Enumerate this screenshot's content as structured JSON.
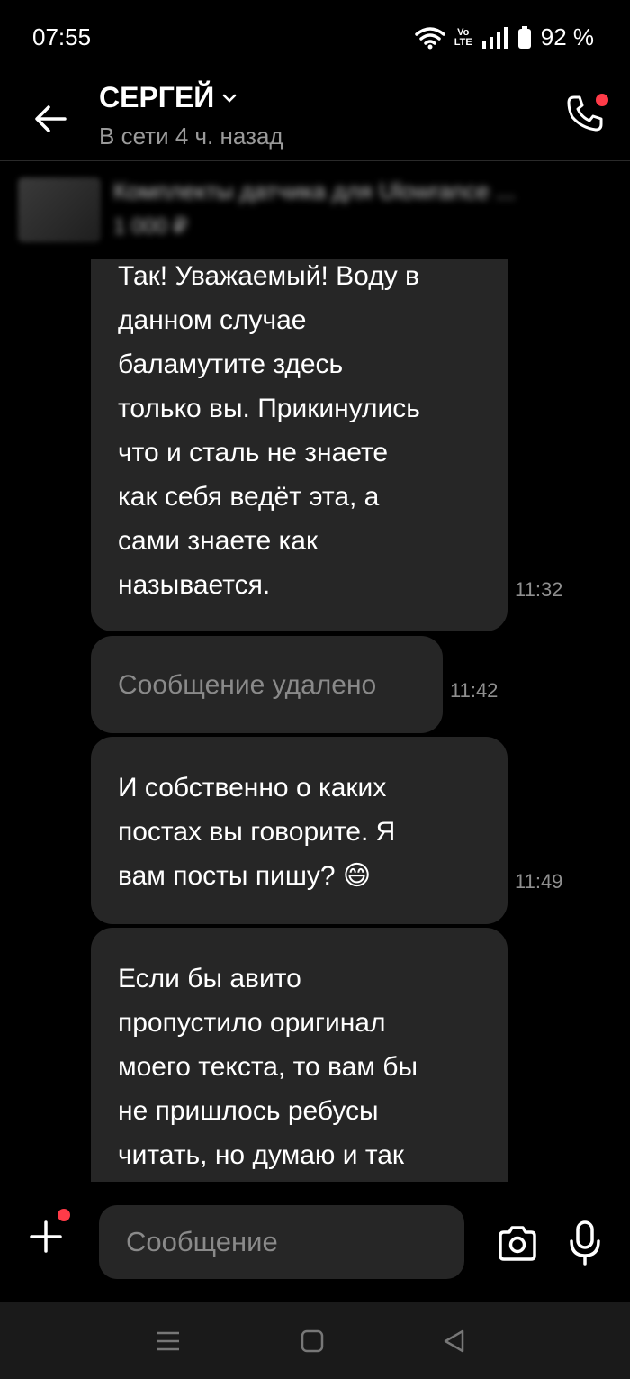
{
  "status_bar": {
    "time": "07:55",
    "volte_top": "Vo",
    "volte_bottom": "LTE",
    "battery": "92 %"
  },
  "header": {
    "contact_name": "СЕРГЕЙ",
    "contact_status": "В сети 4 ч. назад"
  },
  "ad": {
    "title": "Комплекты датчика для Ulowrance ...",
    "price": "1 000 ₽"
  },
  "messages": [
    {
      "text": "Так! Уважаемый! Воду в\nданном случае\nбаламутите здесь\nтолько вы. Прикинулись\nчто и сталь не знаете\nкак себя ведёт эта, а\nсами знаете как\nназывается.",
      "time": "11:32",
      "deleted": false
    },
    {
      "text": "Сообщение удалено",
      "time": "11:42",
      "deleted": true
    },
    {
      "text": "И собственно о каких\nпостах вы говорите. Я\nвам посты пишу? 😄",
      "time": "11:49",
      "deleted": false
    },
    {
      "text": "Если бы авито\nпропустило оригинал\nмоего текста, то вам бы\nне пришлось ребусы\nчитать, но думаю и так",
      "time": "",
      "deleted": false
    }
  ],
  "input": {
    "placeholder": "Сообщение"
  },
  "colors": {
    "background": "#000000",
    "bubble": "#262626",
    "accent_red": "#ff3b48",
    "muted_text": "#8f8f8f"
  },
  "icons": {
    "back": "arrow-left-icon",
    "dropdown": "chevron-down-icon",
    "call": "phone-icon",
    "plus": "plus-icon",
    "camera": "camera-icon",
    "mic": "microphone-icon",
    "nav_menu": "menu-icon",
    "nav_home": "home-square-icon",
    "nav_back": "back-triangle-icon"
  }
}
